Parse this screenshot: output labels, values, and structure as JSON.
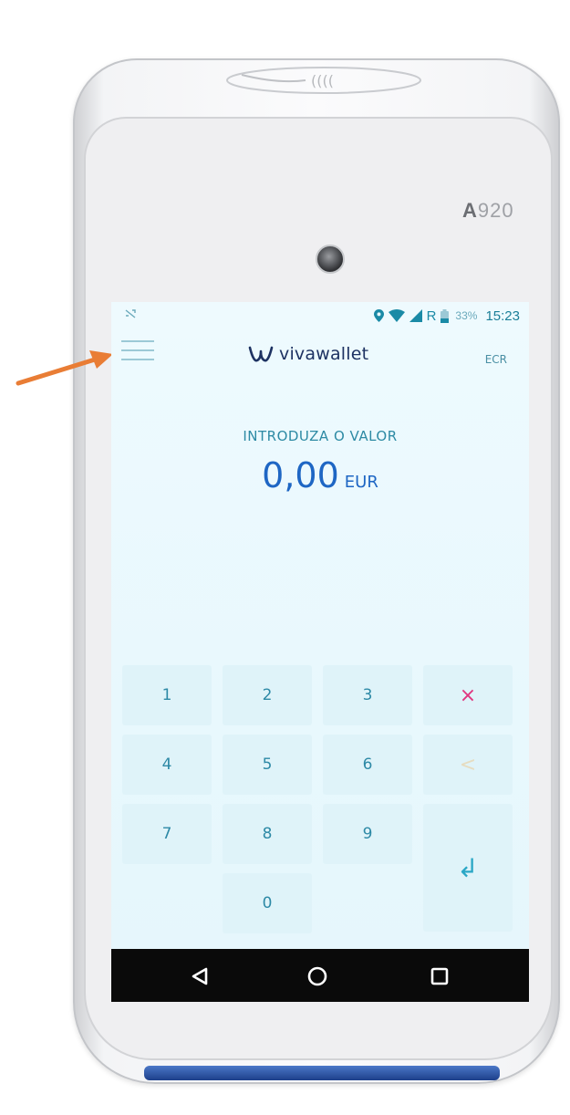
{
  "device": {
    "model": "A920",
    "model_prefix": "A",
    "model_number": "920"
  },
  "status_bar": {
    "battery_percent": "33%",
    "time": "15:23",
    "network_label": "R"
  },
  "header": {
    "brand": "vivawallet",
    "ecr_label": "ECR",
    "menu_icon": "hamburger-menu-icon"
  },
  "amount_entry": {
    "prompt": "INTRODUZA O VALOR",
    "value": "0,00",
    "currency": "EUR"
  },
  "keypad": {
    "k1": "1",
    "k2": "2",
    "k3": "3",
    "k4": "4",
    "k5": "5",
    "k6": "6",
    "k7": "7",
    "k8": "8",
    "k9": "9",
    "k0": "0",
    "clear": "×",
    "backspace": "<",
    "enter": "↲"
  },
  "nav_bar": {
    "back_icon": "back-triangle-icon",
    "home_icon": "home-circle-icon",
    "recents_icon": "recents-square-icon"
  },
  "colors": {
    "arrow": "#e97d35",
    "brand": "#1d3262",
    "accent": "#1e66c4",
    "clear_key": "#e0357f"
  }
}
